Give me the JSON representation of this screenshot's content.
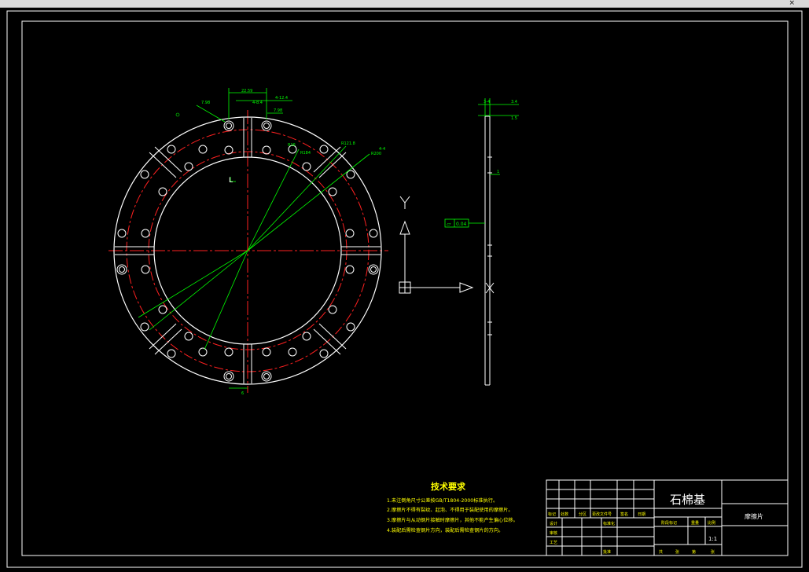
{
  "window": {
    "close_glyph": "×"
  },
  "drawing": {
    "dims_front": [
      "22.59",
      "7.98",
      "4-12.4",
      "4-8.4",
      "7.98",
      "R16",
      "R184",
      "R121.8",
      "R200",
      "4-4",
      "6"
    ],
    "dims_side": [
      "3-4",
      "3.4",
      "1.5",
      "1"
    ],
    "flatness": {
      "symbol": "▱",
      "value": "0.04"
    },
    "axis": {
      "y": "Y",
      "x": "X"
    },
    "section_mark": "L",
    "tech": {
      "title": "技术要求",
      "lines": [
        "1.未注倒角尺寸公差按GB/T1804-2000标准执行。",
        "2.摩擦片不得有裂纹、起泡、不得用于装配使用的摩擦片。",
        "3.摩擦片与从动钢片接触时摩擦片，其他不能产生偏心位移。",
        "4.装配后需检查钢片方向，装配后需检查钢片的方向。"
      ]
    },
    "titleblock": {
      "material": "石棉基",
      "part_name": "摩擦片",
      "row_labels": [
        "标记",
        "处数",
        "分区",
        "更改文件号",
        "签名",
        "日期"
      ],
      "left_labels": [
        "设计",
        "审核",
        "工艺"
      ],
      "mid_labels": [
        "标准化",
        "批准"
      ],
      "stage_labels": [
        "阶段标记",
        "重量",
        "比例"
      ],
      "scale": "1:1",
      "sheet": [
        "共",
        "张",
        "第",
        "张"
      ]
    }
  }
}
